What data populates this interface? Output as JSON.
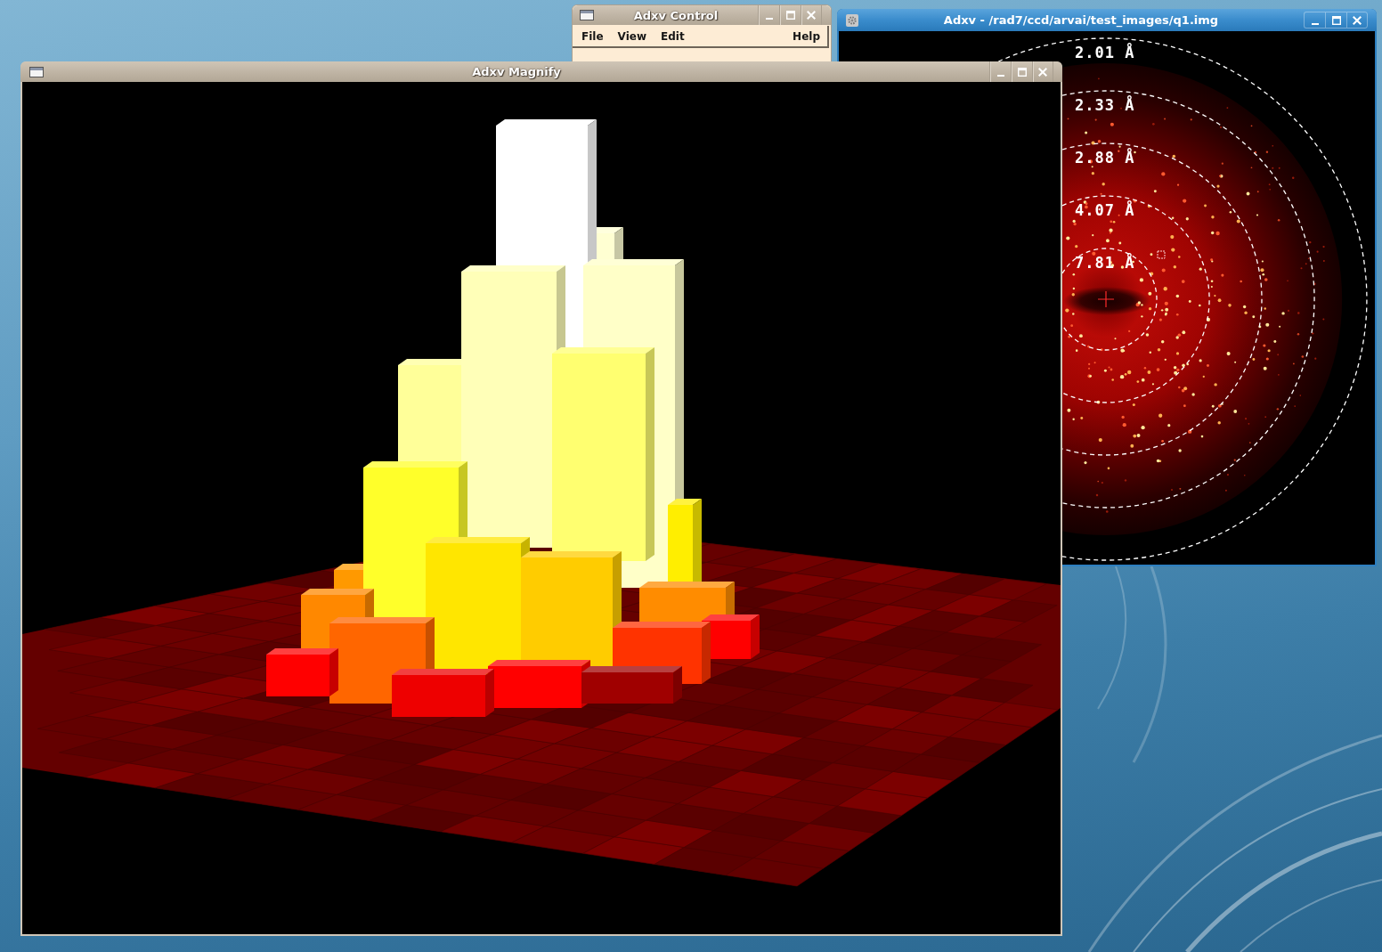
{
  "control_window": {
    "title": "Adxv Control",
    "menu": [
      "File",
      "View",
      "Edit",
      "Help"
    ]
  },
  "image_window": {
    "title": "Adxv - /rad7/ccd/arvai/test_images/q1.img",
    "resolution_rings": [
      {
        "label": "2.01 Å"
      },
      {
        "label": "2.33 Å"
      },
      {
        "label": "2.88 Å"
      },
      {
        "label": "4.07 Å"
      },
      {
        "label": "7.81 Å"
      }
    ]
  },
  "magnify_window": {
    "title": "Adxv Magnify"
  }
}
